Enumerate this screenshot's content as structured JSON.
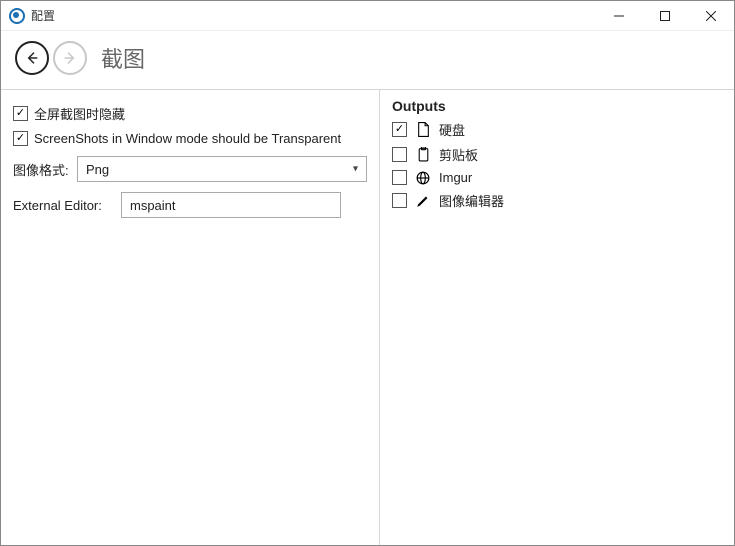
{
  "window": {
    "title": "配置"
  },
  "nav": {
    "page_title": "截图"
  },
  "settings": {
    "hide_on_fullscreen_label": "全屏截图时隐藏",
    "transparent_window_label": "ScreenShots in Window mode should be Transparent",
    "image_format_label": "图像格式:",
    "image_format_value": "Png",
    "external_editor_label": "External Editor:",
    "external_editor_value": "mspaint"
  },
  "outputs": {
    "title": "Outputs",
    "items": [
      {
        "label": "硬盘",
        "checked": true
      },
      {
        "label": "剪贴板",
        "checked": false
      },
      {
        "label": "Imgur",
        "checked": false
      },
      {
        "label": "图像编辑器",
        "checked": false
      }
    ]
  }
}
